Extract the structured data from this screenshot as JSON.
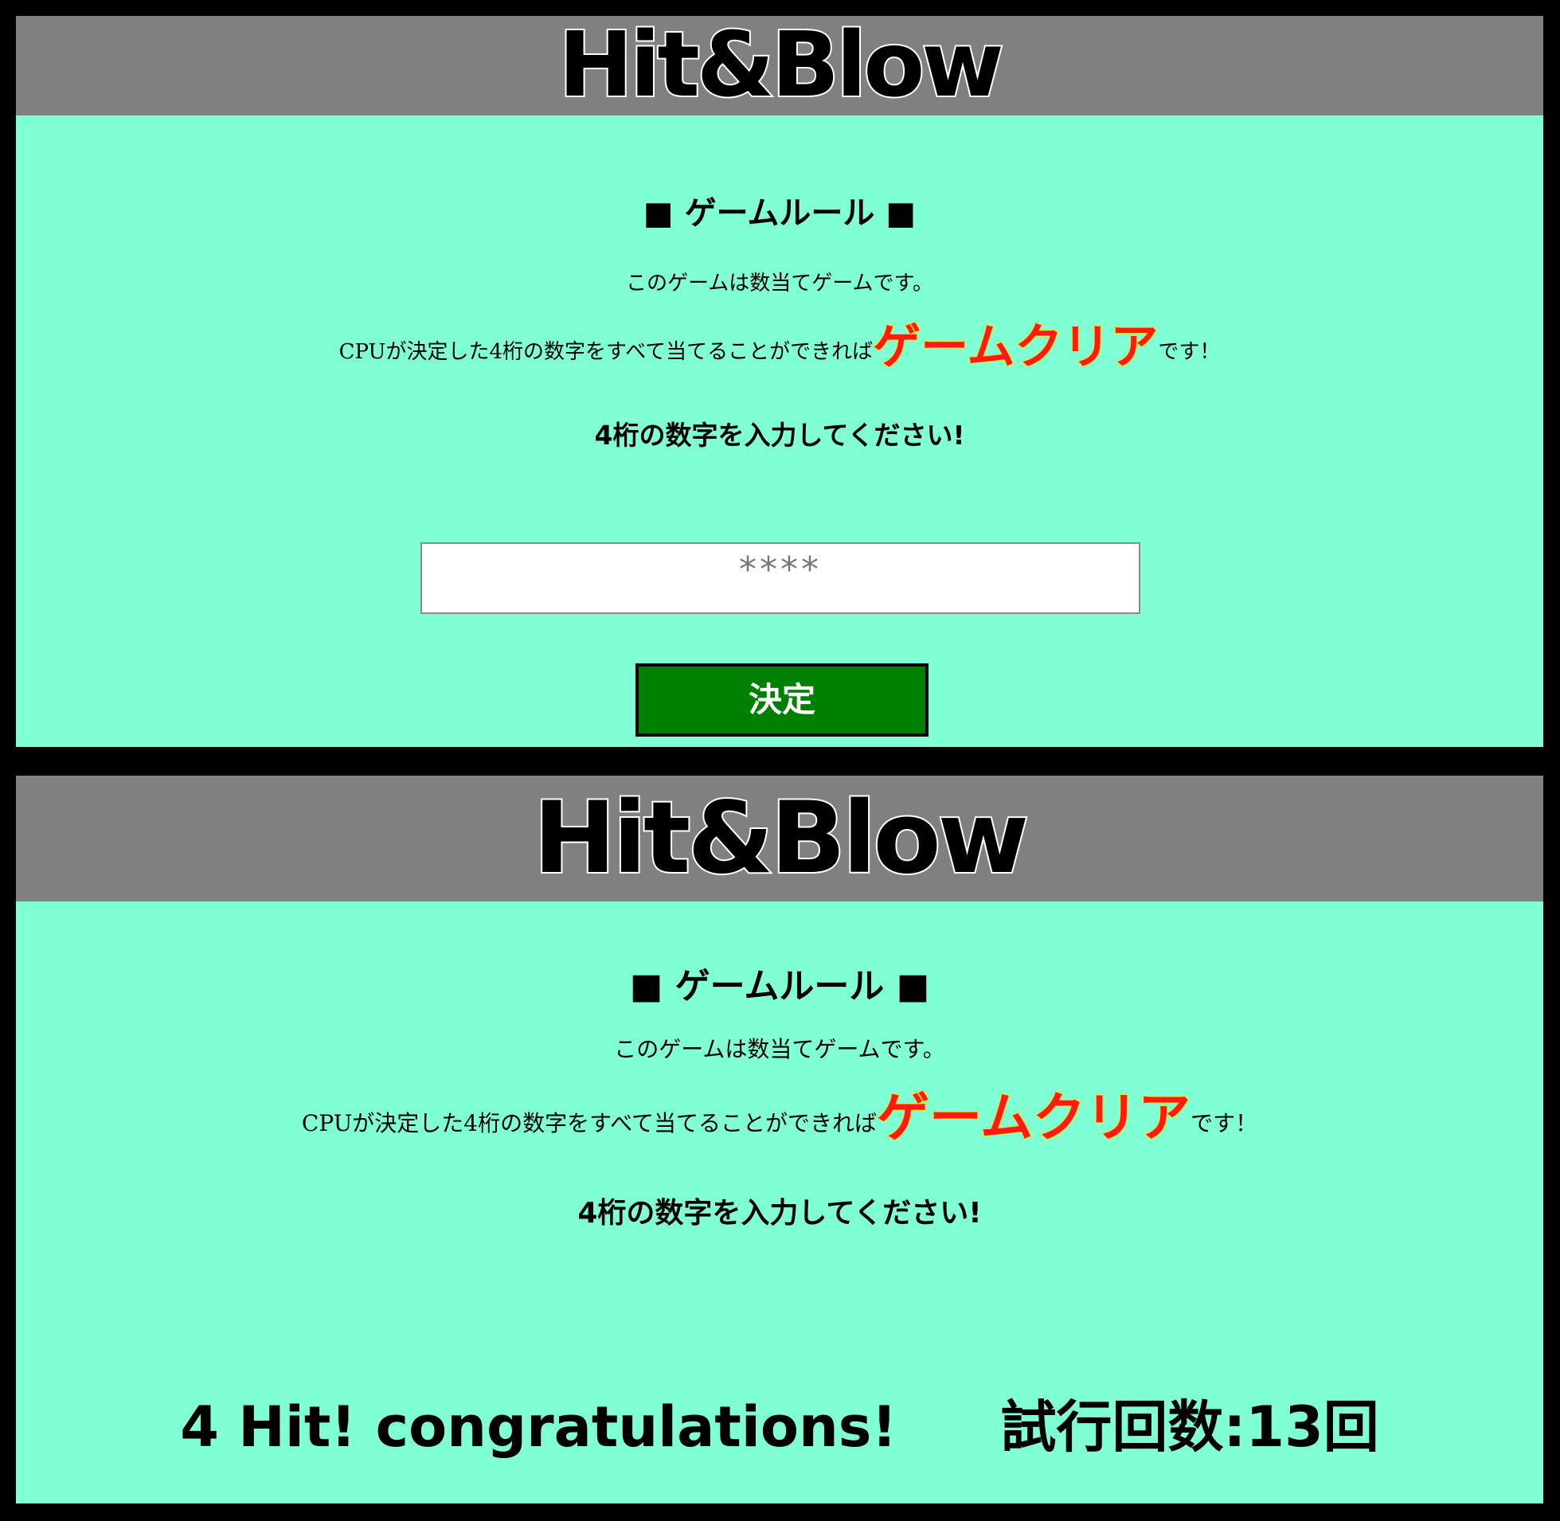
{
  "screens": [
    {
      "title": "Hit&Blow",
      "rules": {
        "heading": "■ ゲームルール ■",
        "line1": "このゲームは数当てゲームです。",
        "line2_before": "CPUが決定した4桁の数字をすべて当てることができれば",
        "line2_highlight": "ゲームクリア",
        "line2_after": "です！"
      },
      "prompt": "4桁の数字を入力してください!",
      "input": {
        "value": "",
        "placeholder": "****"
      },
      "submit_label": "決定"
    },
    {
      "title": "Hit&Blow",
      "rules": {
        "heading": "■ ゲームルール ■",
        "line1": "このゲームは数当てゲームです。",
        "line2_before": "CPUが決定した4桁の数字をすべて当てることができれば",
        "line2_highlight": "ゲームクリア",
        "line2_after": "です！"
      },
      "prompt": "4桁の数字を入力してください!",
      "result": "4 Hit! congratulations!",
      "attempts": "試行回数:13回"
    }
  ],
  "colors": {
    "header_bg": "#808080",
    "page_bg": "#80ffd4",
    "highlight_fill": "#ff1a1a",
    "highlight_outline": "#ffe600",
    "button_bg": "#008000",
    "frame": "#000000"
  }
}
